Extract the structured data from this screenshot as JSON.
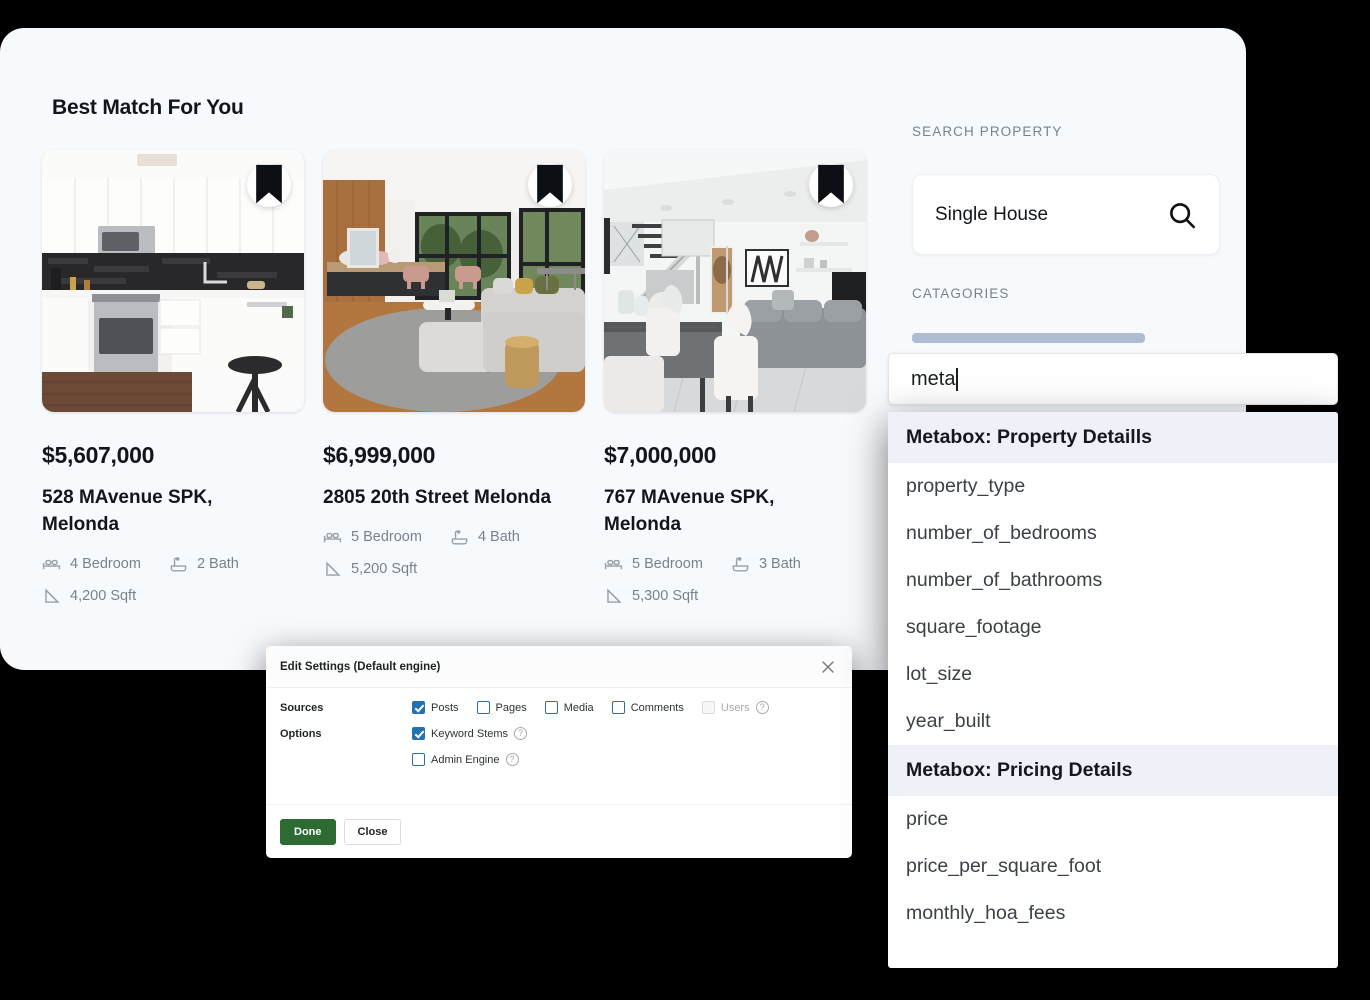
{
  "app": {
    "section_title": "Best Match For You",
    "properties": [
      {
        "price": "$5,607,000",
        "address": "528 MAvenue SPK, Melonda",
        "bedrooms": "4 Bedroom",
        "baths": "2 Bath",
        "sqft": "4,200 Sqft",
        "image_alt": "modern-white-kitchen"
      },
      {
        "price": "$6,999,000",
        "address": "2805 20th Street Melonda",
        "bedrooms": "5 Bedroom",
        "baths": "4 Bath",
        "sqft": "5,200 Sqft",
        "image_alt": "open-living-room-with-garden-windows"
      },
      {
        "price": "$7,000,000",
        "address": "767 MAvenue SPK, Melonda",
        "bedrooms": "5 Bedroom",
        "baths": "3 Bath",
        "sqft": "5,300 Sqft",
        "image_alt": "dining-and-living-area-grey-sofa"
      }
    ],
    "search": {
      "label": "SEARCH PROPERTY",
      "value": "Single House",
      "icon": "search-icon"
    },
    "categories": {
      "label": "CATAGORIES"
    }
  },
  "dialog": {
    "title": "Edit Settings (Default engine)",
    "close_icon": "close-icon",
    "sources_label": "Sources",
    "sources": [
      {
        "label": "Posts",
        "checked": true,
        "disabled": false,
        "help": false
      },
      {
        "label": "Pages",
        "checked": false,
        "disabled": false,
        "help": false
      },
      {
        "label": "Media",
        "checked": false,
        "disabled": false,
        "help": false
      },
      {
        "label": "Comments",
        "checked": false,
        "disabled": false,
        "help": false
      },
      {
        "label": "Users",
        "checked": false,
        "disabled": true,
        "help": true
      }
    ],
    "options_label": "Options",
    "options": [
      {
        "label": "Keyword Stems",
        "checked": true,
        "disabled": false,
        "help": true
      },
      {
        "label": "Admin Engine",
        "checked": false,
        "disabled": false,
        "help": true
      }
    ],
    "done_label": "Done",
    "close_label": "Close",
    "accent_done": "#2e6b33",
    "accent_checkbox": "#2271b1"
  },
  "autocomplete": {
    "input_value": "meta",
    "groups": [
      {
        "title": "Metabox: Property Detaills",
        "items": [
          "property_type",
          "number_of_bedrooms",
          "number_of_bathrooms",
          "square_footage",
          "lot_size",
          "year_built"
        ]
      },
      {
        "title": "Metabox: Pricing Details",
        "items": [
          "price",
          "price_per_square_foot",
          "monthly_hoa_fees"
        ]
      }
    ]
  },
  "colors": {
    "page_background": "#000000",
    "card_background": "#f7fafd",
    "skeleton_bar": "#aebdd3",
    "group_header_background": "#eef1f8"
  }
}
